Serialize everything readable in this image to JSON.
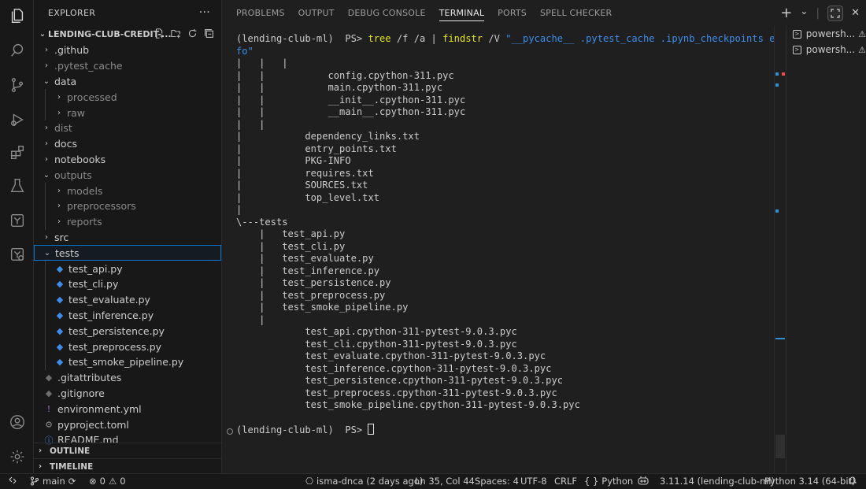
{
  "sidebar": {
    "title": "EXPLORER",
    "more": "···",
    "root": "LENDING-CLUB-CREDIT-...",
    "items": [
      {
        "label": ".github",
        "type": "folder",
        "indent": 1,
        "open": false
      },
      {
        "label": ".pytest_cache",
        "type": "folder",
        "indent": 1,
        "open": false,
        "dim": true
      },
      {
        "label": "data",
        "type": "folder",
        "indent": 1,
        "open": true
      },
      {
        "label": "processed",
        "type": "folder",
        "indent": 2,
        "open": false,
        "dim": true
      },
      {
        "label": "raw",
        "type": "folder",
        "indent": 2,
        "open": false,
        "dim": true
      },
      {
        "label": "dist",
        "type": "folder",
        "indent": 1,
        "open": false,
        "dim": true
      },
      {
        "label": "docs",
        "type": "folder",
        "indent": 1,
        "open": false
      },
      {
        "label": "notebooks",
        "type": "folder",
        "indent": 1,
        "open": false
      },
      {
        "label": "outputs",
        "type": "folder",
        "indent": 1,
        "open": true,
        "dim": true
      },
      {
        "label": "models",
        "type": "folder",
        "indent": 2,
        "open": false,
        "dim": true
      },
      {
        "label": "preprocessors",
        "type": "folder",
        "indent": 2,
        "open": false,
        "dim": true
      },
      {
        "label": "reports",
        "type": "folder",
        "indent": 2,
        "open": false,
        "dim": true
      },
      {
        "label": "src",
        "type": "folder",
        "indent": 1,
        "open": false
      },
      {
        "label": "tests",
        "type": "folder",
        "indent": 1,
        "open": true,
        "selected": true
      },
      {
        "label": "test_api.py",
        "type": "py",
        "indent": 2
      },
      {
        "label": "test_cli.py",
        "type": "py",
        "indent": 2
      },
      {
        "label": "test_evaluate.py",
        "type": "py",
        "indent": 2
      },
      {
        "label": "test_inference.py",
        "type": "py",
        "indent": 2
      },
      {
        "label": "test_persistence.py",
        "type": "py",
        "indent": 2
      },
      {
        "label": "test_preprocess.py",
        "type": "py",
        "indent": 2
      },
      {
        "label": "test_smoke_pipeline.py",
        "type": "py",
        "indent": 2
      },
      {
        "label": ".gitattributes",
        "type": "git",
        "indent": 1
      },
      {
        "label": ".gitignore",
        "type": "git",
        "indent": 1
      },
      {
        "label": "environment.yml",
        "type": "yml",
        "indent": 1
      },
      {
        "label": "pyproject.toml",
        "type": "toml",
        "indent": 1
      },
      {
        "label": "README.md",
        "type": "info",
        "indent": 1
      }
    ],
    "outline": "OUTLINE",
    "timeline": "TIMELINE"
  },
  "panel": {
    "tabs": [
      "PROBLEMS",
      "OUTPUT",
      "DEBUG CONSOLE",
      "TERMINAL",
      "PORTS",
      "SPELL CHECKER"
    ],
    "active_tab": "TERMINAL",
    "new_terminal": "+",
    "dropdown": "⌄",
    "close": "✕"
  },
  "terminal": {
    "prompt": "(lending-club-ml)  PS> ",
    "command_name": "tree",
    "command_args": " /f /a | ",
    "command_name2": "findstr",
    "command_args2": " /V ",
    "command_string": "\"__pycache__ .pytest_cache .ipynb_checkpoints egg-in",
    "command_string2": "fo\"",
    "lines": [
      "|   |   |",
      "|   |           config.cpython-311.pyc",
      "|   |           main.cpython-311.pyc",
      "|   |           __init__.cpython-311.pyc",
      "|   |           __main__.cpython-311.pyc",
      "|   |",
      "|           dependency_links.txt",
      "|           entry_points.txt",
      "|           PKG-INFO",
      "|           requires.txt",
      "|           SOURCES.txt",
      "|           top_level.txt",
      "|",
      "\\---tests",
      "    |   test_api.py",
      "    |   test_cli.py",
      "    |   test_evaluate.py",
      "    |   test_inference.py",
      "    |   test_persistence.py",
      "    |   test_preprocess.py",
      "    |   test_smoke_pipeline.py",
      "    |",
      "            test_api.cpython-311-pytest-9.0.3.pyc",
      "            test_cli.cpython-311-pytest-9.0.3.pyc",
      "            test_evaluate.cpython-311-pytest-9.0.3.pyc",
      "            test_inference.cpython-311-pytest-9.0.3.pyc",
      "            test_persistence.cpython-311-pytest-9.0.3.pyc",
      "            test_preprocess.cpython-311-pytest-9.0.3.pyc",
      "            test_smoke_pipeline.cpython-311-pytest-9.0.3.pyc",
      ""
    ],
    "final_prompt": "(lending-club-ml)  PS> "
  },
  "terminal_list": [
    {
      "label": "powersh...",
      "warn": "⚠"
    },
    {
      "label": "powersh...",
      "warn": "⚠"
    }
  ],
  "status": {
    "branch": "main",
    "errors": "0",
    "warnings": "0",
    "blame": "isma-dnca (2 days ago)",
    "position": "Ln 35, Col 44",
    "spaces": "Spaces: 4",
    "encoding": "UTF-8",
    "eol": "CRLF",
    "language": "Python",
    "env": "3.11.14 (lending-club-ml)",
    "interpreter": "Python 3.14 (64-bit)"
  },
  "colors": {
    "accent": "#0078d4",
    "command": "#e5e510",
    "string": "#3b8eea",
    "python_icon": "#3b8eea"
  }
}
